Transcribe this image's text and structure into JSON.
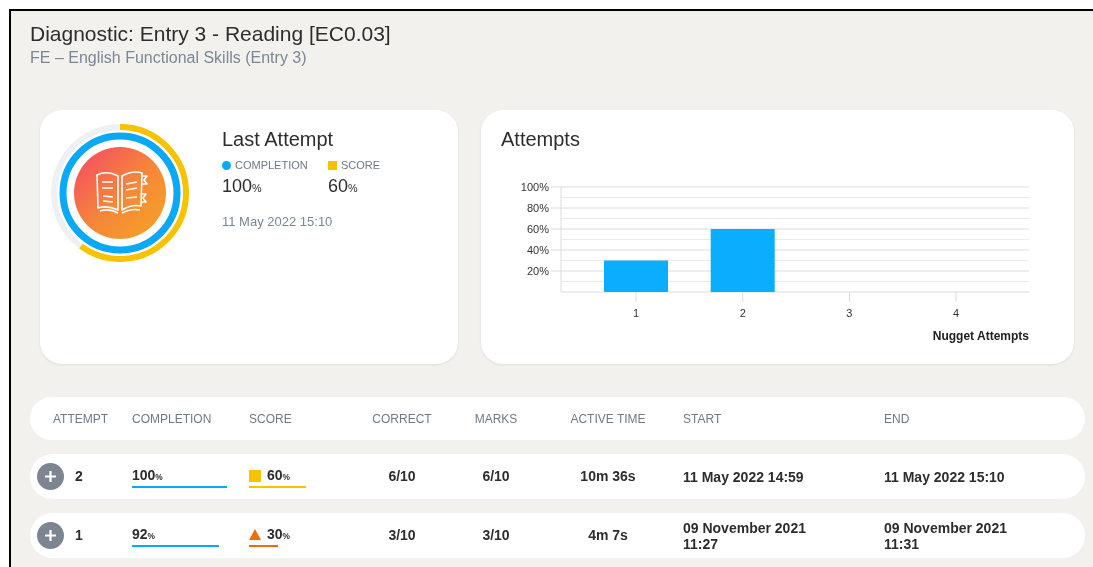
{
  "header": {
    "title": "Diagnostic: Entry 3 - Reading [EC0.03]",
    "subtitle": "FE – English Functional Skills (Entry 3)"
  },
  "last_attempt": {
    "title": "Last Attempt",
    "completion": {
      "label": "COMPLETION",
      "value": "100",
      "unit": "%",
      "level": 1,
      "color": "#0aa8f5"
    },
    "score": {
      "label": "SCORE",
      "value": "60",
      "unit": "%",
      "level": 0.6,
      "color": "#f7c300"
    },
    "date": "11 May 2022 15:10"
  },
  "attempts_card": {
    "title": "Attempts",
    "chart_data": {
      "type": "bar",
      "xlabel": "Nugget Attempts",
      "categories": [
        "1",
        "2",
        "3",
        "4"
      ],
      "series": [
        {
          "color": "#0aaefc",
          "values": [
            30,
            60,
            null,
            null
          ]
        }
      ],
      "grid": true,
      "ylim": [
        0,
        100
      ],
      "yticks": [
        {
          "value": 20,
          "label": "20%"
        },
        {
          "value": 40,
          "label": "40%"
        },
        {
          "value": 60,
          "label": "60%"
        },
        {
          "value": 80,
          "label": "80%"
        },
        {
          "value": 100,
          "label": "100%"
        }
      ]
    }
  },
  "table": {
    "columns": [
      "ATTEMPT",
      "COMPLETION",
      "SCORE",
      "CORRECT",
      "MARKS",
      "ACTIVE TIME",
      "START",
      "END"
    ],
    "rows": [
      {
        "attempt": "2",
        "completion": {
          "value": "100",
          "unit": "%"
        },
        "score": {
          "kind": "square",
          "color": "#f7c300",
          "value": "60",
          "unit": "%"
        },
        "correct": "6/10",
        "marks": "6/10",
        "active_time": "10m 36s",
        "start": "11 May 2022 14:59",
        "end": "11 May 2022 15:10"
      },
      {
        "attempt": "1",
        "completion": {
          "value": "92",
          "unit": "%"
        },
        "score": {
          "kind": "triangle",
          "color": "#f26a10",
          "value": "30",
          "unit": "%"
        },
        "correct": "3/10",
        "marks": "3/10",
        "active_time": "4m 7s",
        "start": "09 November 2021 11:27",
        "end": "09 November 2021 11:31"
      }
    ]
  }
}
